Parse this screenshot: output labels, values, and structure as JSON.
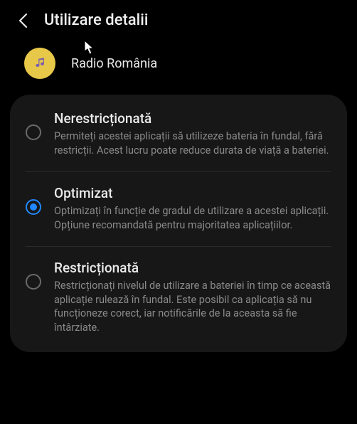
{
  "header": {
    "title": "Utilizare detalii"
  },
  "app": {
    "name": "Radio România",
    "icon": "music-note-icon",
    "icon_bg": "#e8c848"
  },
  "options": [
    {
      "key": "unrestricted",
      "title": "Nerestricționată",
      "desc": "Permiteți acestei aplicații să utilizeze bateria în fundal, fără restricții. Acest lucru poate reduce durata de viață a bateriei.",
      "selected": false
    },
    {
      "key": "optimized",
      "title": "Optimizat",
      "desc": "Optimizați în funcție de gradul de utilizare a acestei aplicații. Opțiune recomandată pentru majoritatea aplicațiilor.",
      "selected": true
    },
    {
      "key": "restricted",
      "title": "Restricționată",
      "desc": "Restricționați nivelul de utilizare a bateriei în timp ce această aplicație rulează în fundal. Este posibil ca aplicația să nu funcționeze corect, iar notificările de la aceasta să fie întârziate.",
      "selected": false
    }
  ]
}
